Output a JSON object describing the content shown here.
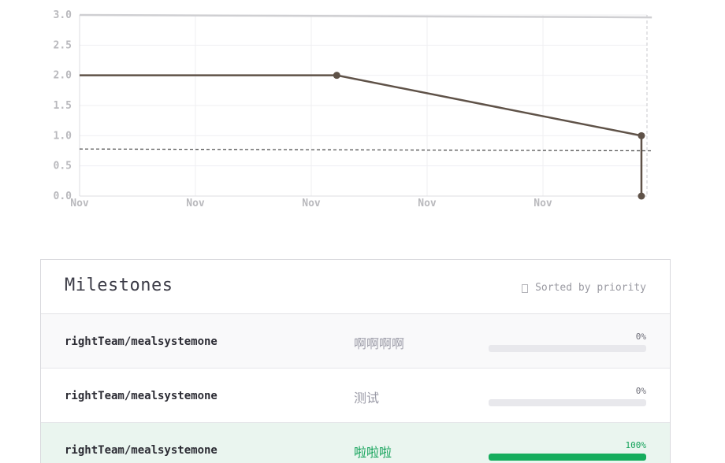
{
  "chart_data": {
    "type": "line",
    "y_ticks": [
      "3.0",
      "2.5",
      "2.0",
      "1.5",
      "1.0",
      "0.5",
      "0.0"
    ],
    "x_ticks": [
      "Nov",
      "Nov",
      "Nov",
      "Nov",
      "Nov"
    ],
    "ylim": [
      0,
      3
    ],
    "grid": true,
    "series": [
      {
        "style": "solid",
        "color": "#5f5248",
        "points": [
          [
            0,
            2.0
          ],
          [
            2.22,
            2.0
          ],
          [
            4.85,
            1.0
          ],
          [
            4.85,
            0.0
          ]
        ]
      },
      {
        "style": "dashed",
        "color": "#555555",
        "points": [
          [
            0,
            0.78
          ],
          [
            4.94,
            0.75
          ]
        ]
      },
      {
        "style": "solid",
        "color": "#cfcfd2",
        "points": [
          [
            0,
            3.0
          ],
          [
            4.94,
            2.96
          ]
        ]
      }
    ],
    "markers": [
      [
        2.22,
        2.0
      ],
      [
        4.85,
        1.0
      ],
      [
        4.85,
        0.0
      ]
    ]
  },
  "milestones": {
    "title": "Milestones",
    "sort_label": "Sorted by priority",
    "sort_icon": "sort-icon",
    "rows": [
      {
        "repo": "rightTeam/mealsystemone",
        "name": "啊啊啊啊",
        "percent": "0%",
        "progress": 0
      },
      {
        "repo": "rightTeam/mealsystemone",
        "name": "测试",
        "percent": "0%",
        "progress": 0
      },
      {
        "repo": "rightTeam/mealsystemone",
        "name": "啦啦啦",
        "percent": "100%",
        "progress": 100
      }
    ]
  }
}
